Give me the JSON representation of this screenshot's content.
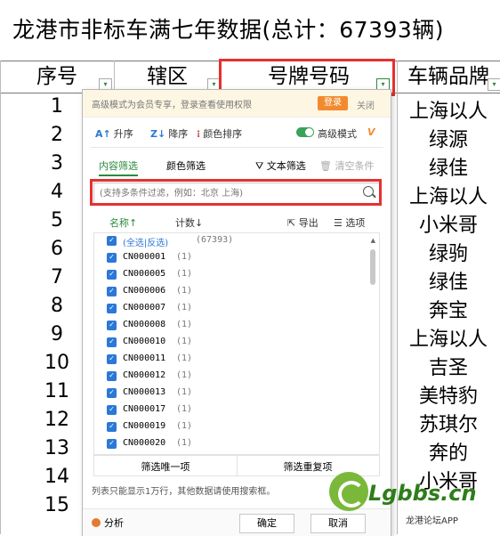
{
  "title": "龙港市非标车满七年数据(总计：67393辆)",
  "columns": {
    "seq": "序号",
    "district": "辖区",
    "plate": "号牌号码",
    "brand": "车辆品牌"
  },
  "rows": [
    {
      "seq": "1",
      "brand": "上海以人"
    },
    {
      "seq": "2",
      "brand": "绿源"
    },
    {
      "seq": "3",
      "brand": "绿佳"
    },
    {
      "seq": "4",
      "brand": "上海以人"
    },
    {
      "seq": "5",
      "brand": "小米哥"
    },
    {
      "seq": "6",
      "brand": "绿驹"
    },
    {
      "seq": "7",
      "brand": "绿佳"
    },
    {
      "seq": "8",
      "brand": "奔宝"
    },
    {
      "seq": "9",
      "brand": "上海以人"
    },
    {
      "seq": "10",
      "brand": "吉圣"
    },
    {
      "seq": "11",
      "brand": "美特豹"
    },
    {
      "seq": "12",
      "brand": "苏琪尔"
    },
    {
      "seq": "13",
      "brand": "奔的"
    },
    {
      "seq": "14",
      "brand": "小米哥"
    },
    {
      "seq": "15",
      "brand": ""
    }
  ],
  "filter_panel": {
    "promo_text": "高级模式为会员专享，登录查看使用权限",
    "login_label": "登录",
    "close_label": "关闭",
    "sort_asc_label": "升序",
    "sort_desc_label": "降序",
    "color_sort_label": "颜色排序",
    "advanced_mode_label": "高级模式",
    "tab_content": "内容筛选",
    "tab_color": "颜色筛选",
    "text_filter_label": "文本筛选",
    "clear_label": "清空条件",
    "search_placeholder": "(支持多条件过滤，例如：北京 上海)",
    "name_header": "名称↑",
    "count_header": "计数↓",
    "export_label": "导出",
    "options_label": "选项",
    "select_all_label": "(全选|反选)",
    "select_all_count": "(67393)",
    "items": [
      {
        "code": "CN000001",
        "count": "(1)"
      },
      {
        "code": "CN000005",
        "count": "(1)"
      },
      {
        "code": "CN000006",
        "count": "(1)"
      },
      {
        "code": "CN000007",
        "count": "(1)"
      },
      {
        "code": "CN000008",
        "count": "(1)"
      },
      {
        "code": "CN000010",
        "count": "(1)"
      },
      {
        "code": "CN000011",
        "count": "(1)"
      },
      {
        "code": "CN000012",
        "count": "(1)"
      },
      {
        "code": "CN000013",
        "count": "(1)"
      },
      {
        "code": "CN000017",
        "count": "(1)"
      },
      {
        "code": "CN000019",
        "count": "(1)"
      },
      {
        "code": "CN000020",
        "count": "(1)"
      }
    ],
    "unique_label": "筛选唯一项",
    "duplicate_label": "筛选重复项",
    "note": "列表只能显示1万行，其他数据请使用搜索框。",
    "analyze_label": "分析",
    "ok_label": "确定",
    "cancel_label": "取消"
  },
  "watermark": {
    "site": "Lgbbs.cn",
    "name": "龙港论坛APP"
  }
}
